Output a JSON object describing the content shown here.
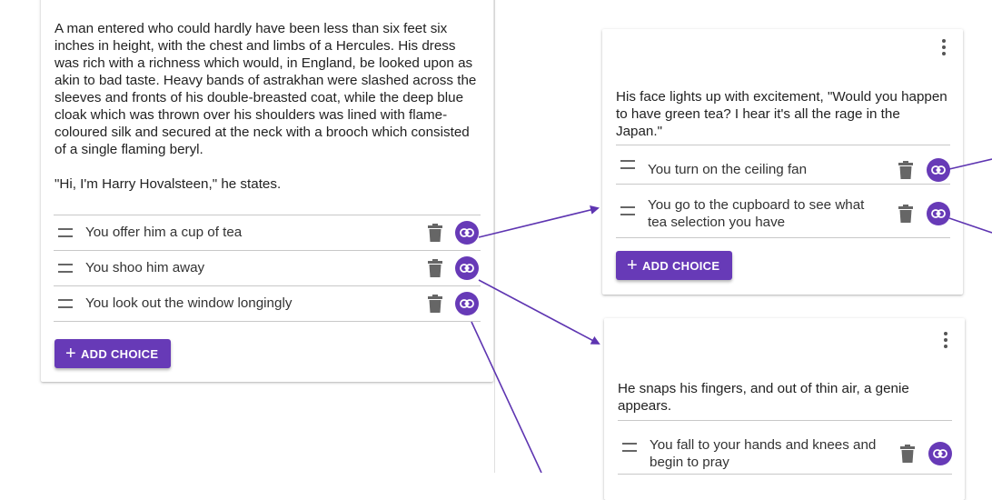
{
  "accent_color": "#673ab7",
  "cards": {
    "left": {
      "passage": [
        "A man entered who could hardly have been less than six feet six inches in height, with the chest and limbs of a Hercules. His dress was rich with a richness which would, in England, be looked upon as akin to bad taste. Heavy bands of astrakhan were slashed across the sleeves and fronts of his double-breasted coat, while the deep blue cloak which was thrown over his shoulders was lined with flame-coloured silk and secured at the neck with a brooch which consisted of a single flaming beryl.",
        "\"Hi, I'm Harry Hovalsteen,\" he states."
      ],
      "choices": [
        "You offer him a cup of tea",
        "You shoo him away",
        "You look out the window longingly"
      ],
      "add_choice_label": "ADD CHOICE"
    },
    "top_right": {
      "passage": "His face lights up with excitement, \"Would you happen to have green tea? I hear it's all the rage in the Japan.\"",
      "choices": [
        "You turn on the ceiling fan",
        "You go to the cupboard to see what tea selection you have"
      ],
      "add_choice_label": "ADD CHOICE"
    },
    "bottom_right": {
      "passage": "He snaps his fingers, and out of thin air, a genie appears.",
      "choices": [
        "You fall to your hands and knees and begin to pray"
      ]
    }
  },
  "icons": [
    "drag-handle-icon",
    "trash-icon",
    "link-icon",
    "plus-icon",
    "more-vert-icon"
  ]
}
